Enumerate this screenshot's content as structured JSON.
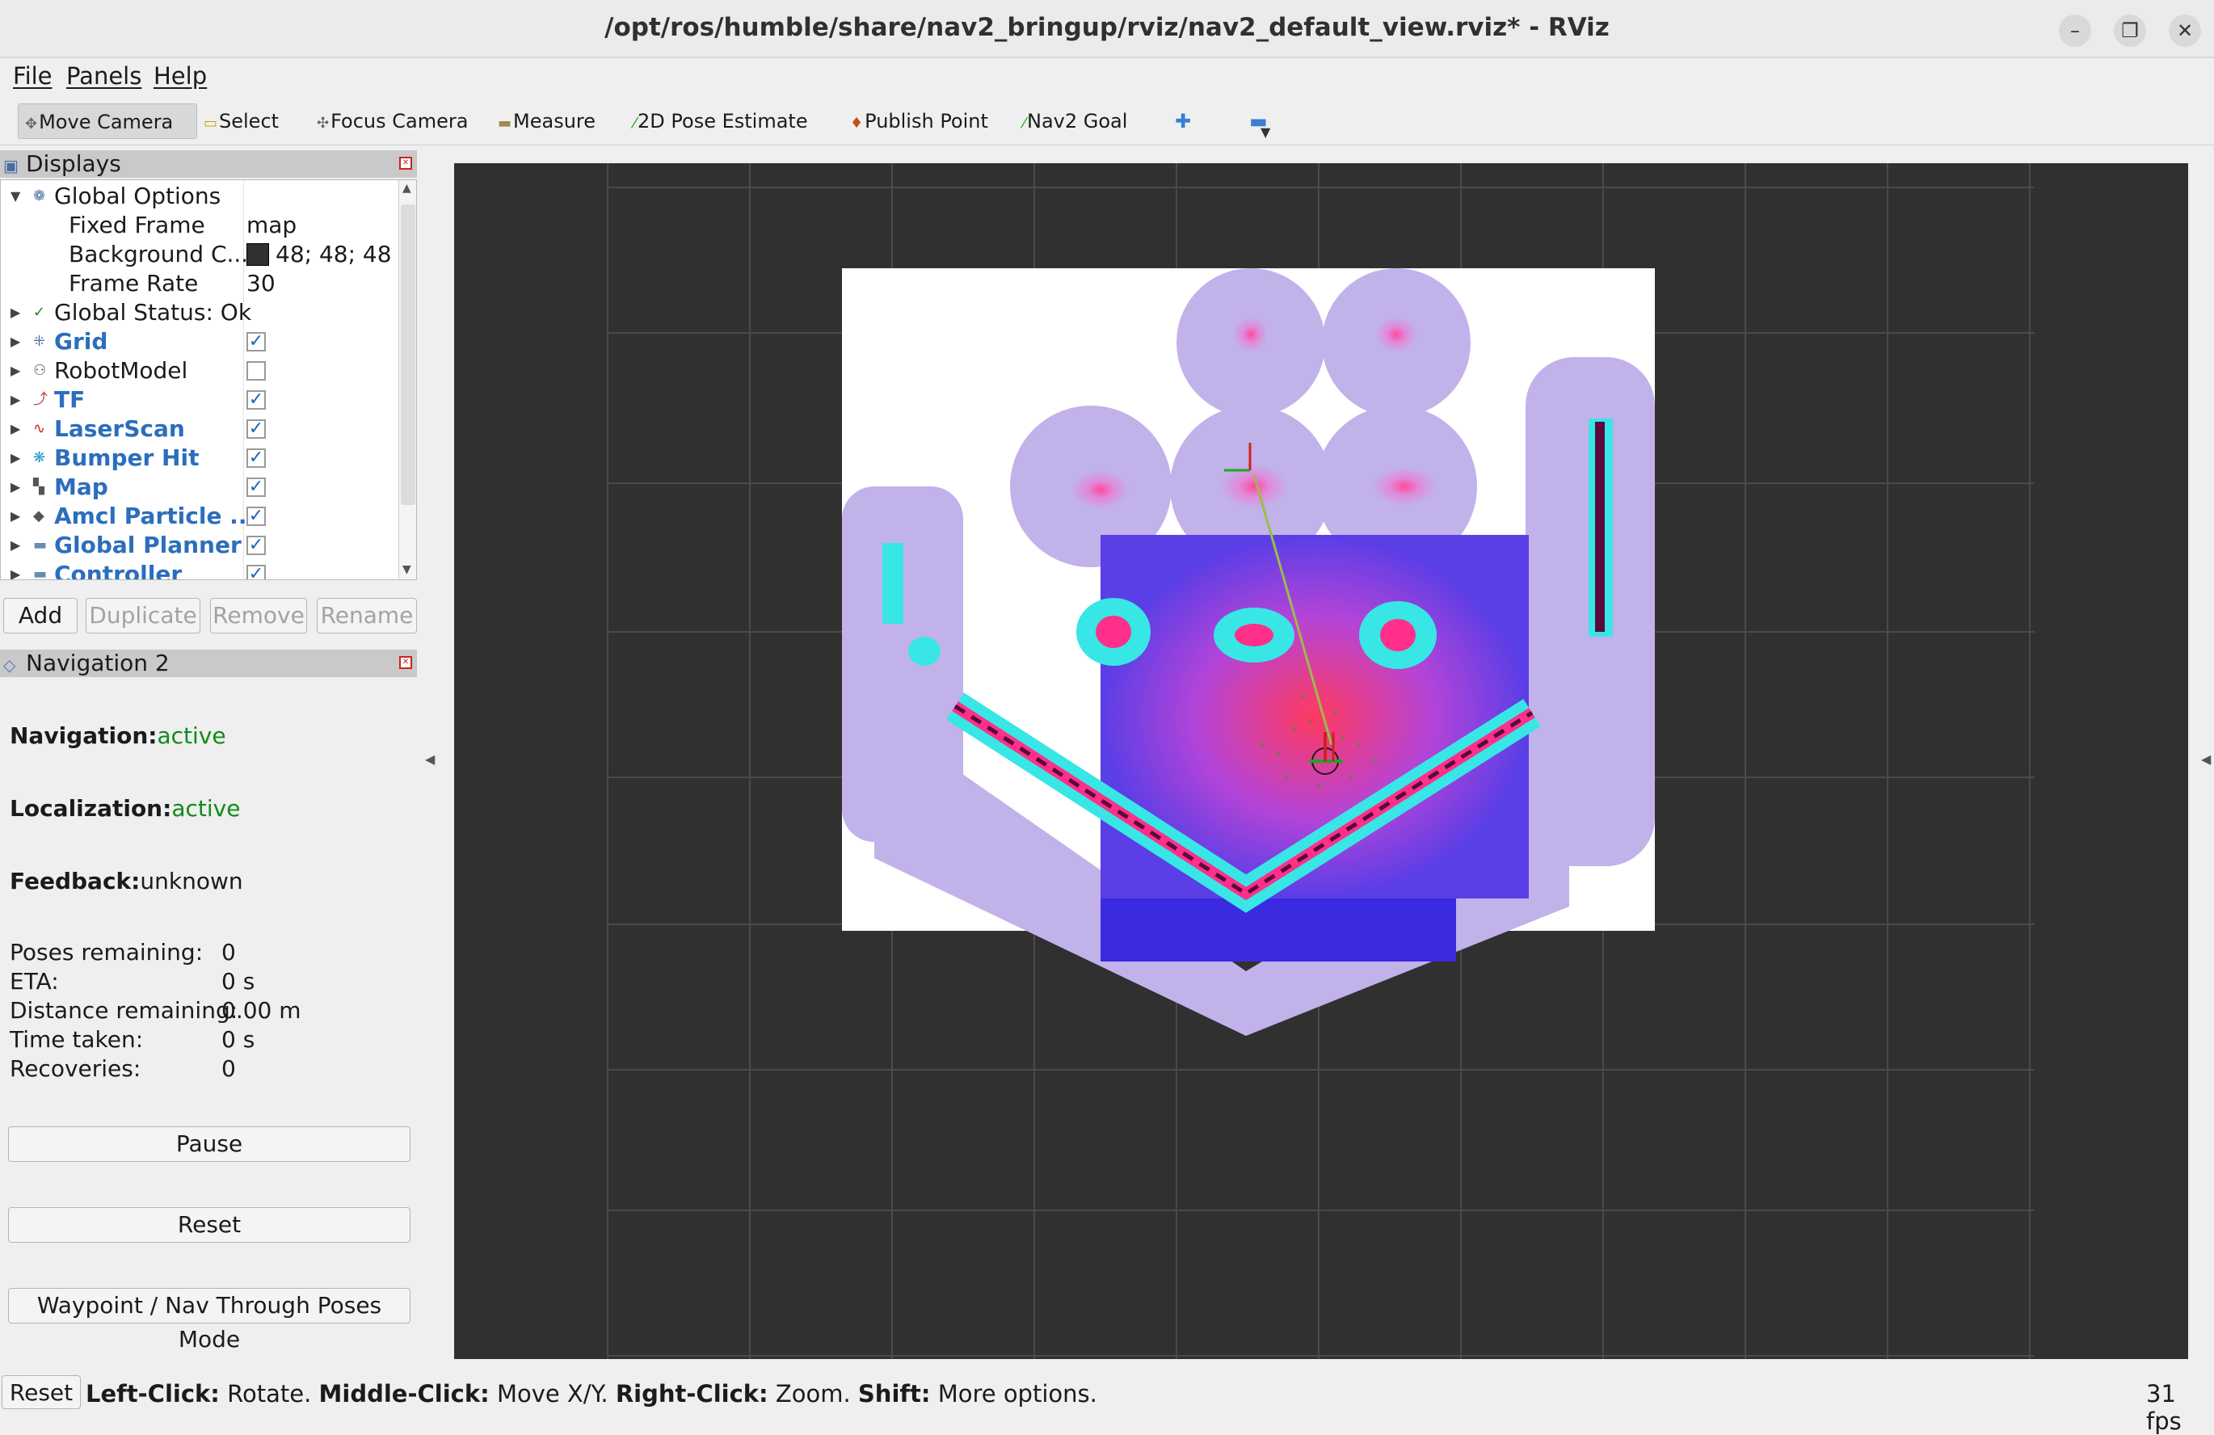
{
  "window": {
    "title": "/opt/ros/humble/share/nav2_bringup/rviz/nav2_default_view.rviz* - RViz",
    "controls": [
      "–",
      "❐",
      "✕"
    ]
  },
  "menu": [
    "File",
    "Panels",
    "Help"
  ],
  "toolbar": {
    "move_camera": "Move Camera",
    "select": "Select",
    "focus_camera": "Focus Camera",
    "measure": "Measure",
    "pose_estimate": "2D Pose Estimate",
    "publish_point": "Publish Point",
    "nav2_goal": "Nav2 Goal"
  },
  "displays": {
    "title": "Displays",
    "global_options": "Global Options",
    "fixed_frame_label": "Fixed Frame",
    "fixed_frame_value": "map",
    "bg_label": "Background C...",
    "bg_value": "48; 48; 48",
    "bg_swatch": "#303030",
    "frame_rate_label": "Frame Rate",
    "frame_rate_value": "30",
    "global_status": "Global Status: Ok",
    "items": [
      {
        "label": "Grid",
        "checked": true
      },
      {
        "label": "RobotModel",
        "checked": false
      },
      {
        "label": "TF",
        "checked": true
      },
      {
        "label": "LaserScan",
        "checked": true
      },
      {
        "label": "Bumper Hit",
        "checked": true
      },
      {
        "label": "Map",
        "checked": true
      },
      {
        "label": "Amcl Particle ...",
        "checked": true
      },
      {
        "label": "Global Planner",
        "checked": true
      },
      {
        "label": "Controller",
        "checked": true
      }
    ],
    "buttons": {
      "add": "Add",
      "duplicate": "Duplicate",
      "remove": "Remove",
      "rename": "Rename"
    }
  },
  "nav2": {
    "title": "Navigation 2",
    "navigation_label": "Navigation:",
    "navigation_value": "active",
    "localization_label": "Localization:",
    "localization_value": "active",
    "feedback_label": "Feedback:",
    "feedback_value": "unknown",
    "stats": [
      {
        "label": "Poses remaining:",
        "value": "0"
      },
      {
        "label": "ETA:",
        "value": "0 s"
      },
      {
        "label": "Distance remaining:",
        "value": "0.00 m"
      },
      {
        "label": "Time taken:",
        "value": "0 s"
      },
      {
        "label": "Recoveries:",
        "value": "0"
      }
    ],
    "pause": "Pause",
    "reset": "Reset",
    "mode": "Waypoint / Nav Through Poses Mode"
  },
  "status": {
    "reset": "Reset",
    "left_click": "Left-Click:",
    "left_click_action": "Rotate.",
    "middle_click": "Middle-Click:",
    "middle_click_action": "Move X/Y.",
    "right_click": "Right-Click:",
    "right_click_action": "Zoom.",
    "shift": "Shift:",
    "shift_action": "More options.",
    "fps": "31 fps"
  },
  "colors": {
    "view_background": "#303030",
    "active": "#118a1a",
    "display_link": "#2c6ebc"
  }
}
